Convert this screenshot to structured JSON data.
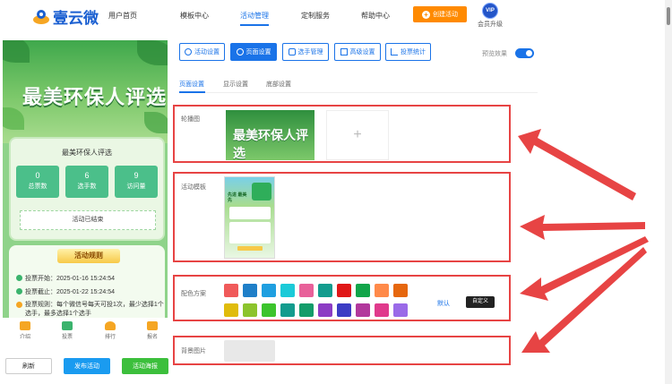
{
  "nav": {
    "logo": "壹云微",
    "items": [
      "用户首页",
      "模板中心",
      "活动管理",
      "定制服务",
      "帮助中心"
    ],
    "create_label": "创建活动",
    "vip_badge": "VIP",
    "vip_label": "会员升级"
  },
  "preview": {
    "banner_title": "最美环保人评选",
    "card_title": "最美环保人评选",
    "stats": [
      {
        "value": "0",
        "label": "总票数"
      },
      {
        "value": "6",
        "label": "选手数"
      },
      {
        "value": "9",
        "label": "访问量"
      }
    ],
    "ended": "活动已结束",
    "rules_title": "活动规则",
    "rules": [
      "投票开始：2025-01-16 15:24:54",
      "投票截止：2025-01-22 15:24:54",
      "投票规则：每个微信号每天可投1次，最少选择1个选手，最多选择1个选手"
    ],
    "tabs": [
      "介绍",
      "投票",
      "排行",
      "报名"
    ],
    "buttons": {
      "refresh": "刷新",
      "publish": "发布活动",
      "poster": "活动海报"
    }
  },
  "toolbar": {
    "buttons": [
      "活动设置",
      "页面设置",
      "选手管理",
      "高级设置",
      "投票统计"
    ],
    "preview_label": "预览效果"
  },
  "subtabs": [
    "页面设置",
    "显示设置",
    "底部设置"
  ],
  "sections": {
    "carousel_label": "轮播图",
    "carousel_image_text": "最美环保人评选",
    "add_icon": "+",
    "template_label": "活动模板",
    "template_thumb_text": "先进 最美先",
    "color_label": "配色方案",
    "default_label": "默认",
    "custom_label": "自定义",
    "bg_label": "背景图片"
  },
  "colors": {
    "row1": [
      "#f05a5a",
      "#1f7fc8",
      "#1f9fe0",
      "#1ccad8",
      "#e8619a",
      "#139c8e",
      "#e01818",
      "#12a54a",
      "#ff8a4a",
      "#e6670e"
    ],
    "row2": [
      "#e0bc0c",
      "#8cc42c",
      "#3cc42c",
      "#139c8e",
      "#139c6a",
      "#8c3cc4",
      "#3c3cc4",
      "#b2389c",
      "#e03a8c",
      "#9a6ae8"
    ],
    "accent": "#1a73e8",
    "arrow": "#e74444"
  }
}
